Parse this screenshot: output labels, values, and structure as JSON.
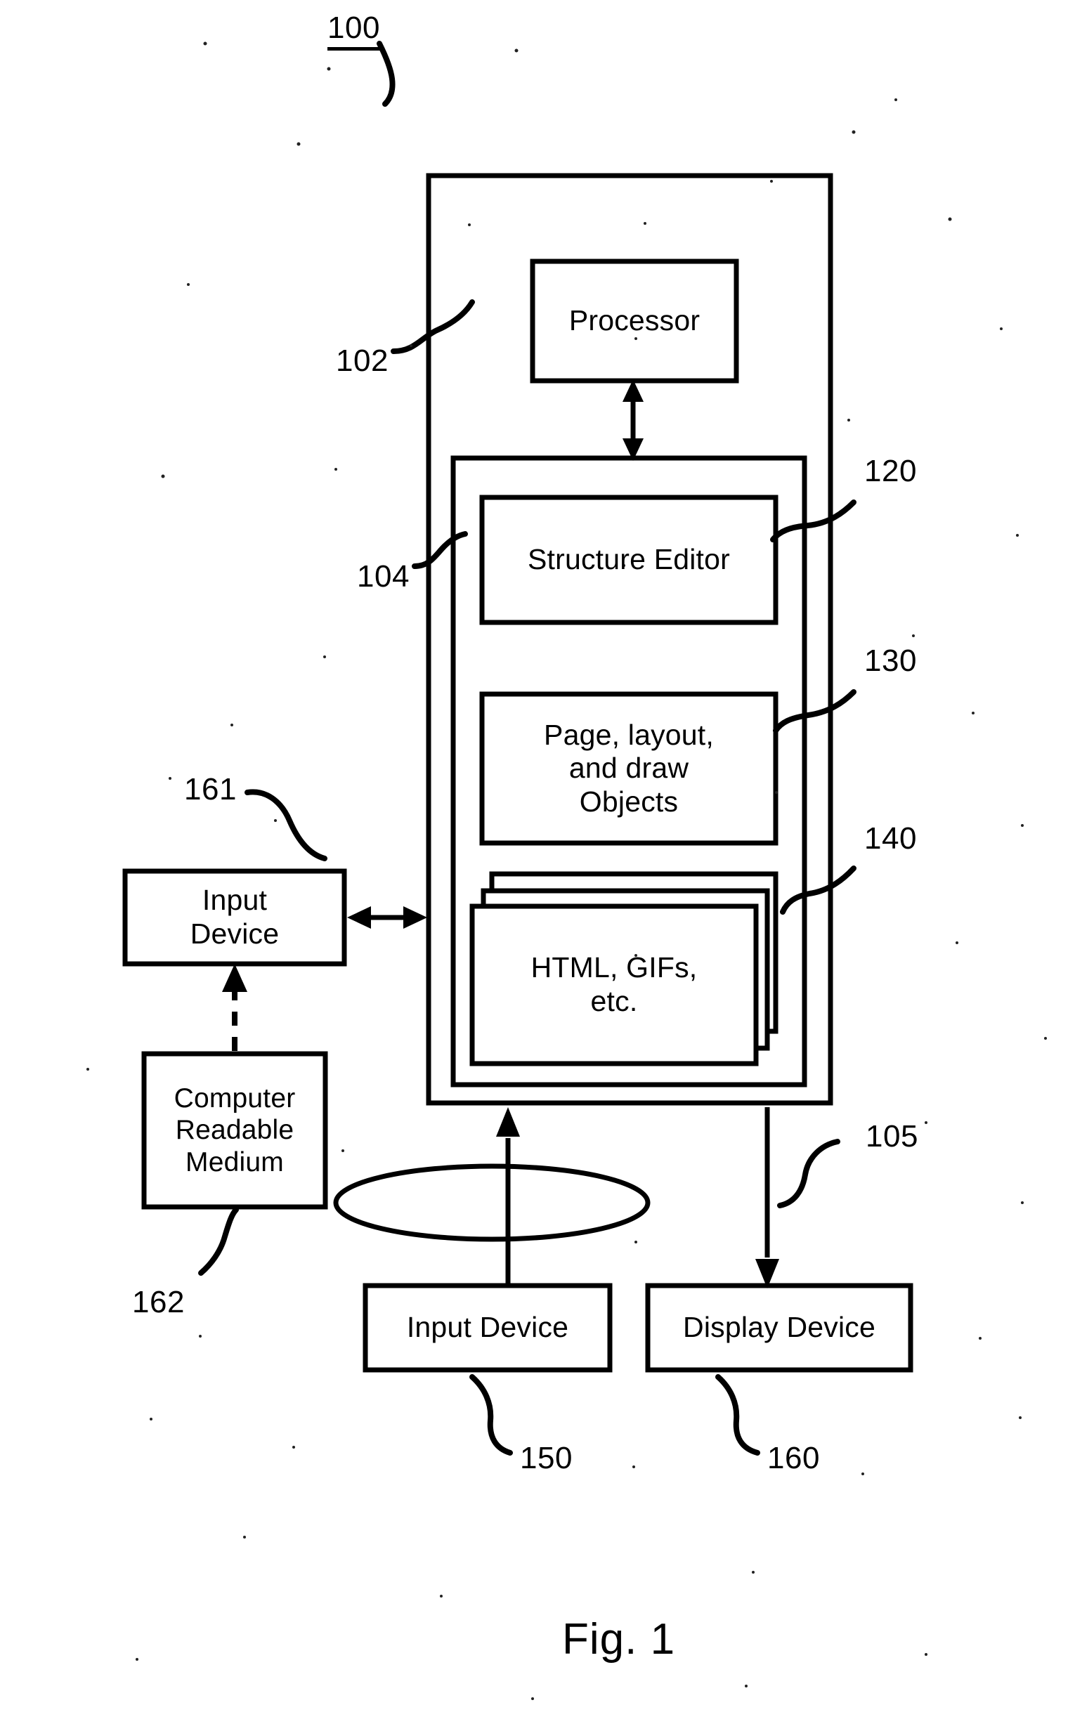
{
  "figure": {
    "number_label": "100",
    "caption": "Fig. 1"
  },
  "reference_numerals": {
    "system": "100",
    "computer_outer": "102",
    "memory_container": "104",
    "bus": "105",
    "structure_editor": "120",
    "page_layout_objects": "130",
    "content_files": "140",
    "input_device_bottom": "150",
    "display_device": "160",
    "input_device_left": "161",
    "computer_readable_medium": "162"
  },
  "blocks": {
    "processor": {
      "label": "Processor",
      "lines": [
        "Processor"
      ]
    },
    "structure_editor": {
      "label": "Structure Editor",
      "lines": [
        "Structure Editor"
      ]
    },
    "page_layout_objects": {
      "label": "Page, layout, and draw Objects",
      "lines": [
        "Page, layout,",
        "and draw",
        "Objects"
      ]
    },
    "content_files": {
      "label": "HTML, GIFs, etc.",
      "lines": [
        "HTML, GIFs,",
        "etc."
      ]
    },
    "input_device_left": {
      "label": "Input Device",
      "lines": [
        "Input",
        "Device"
      ]
    },
    "computer_readable_medium": {
      "label": "Computer Readable Medium",
      "lines": [
        "Computer",
        "Readable",
        "Medium"
      ]
    },
    "input_device_bottom": {
      "label": "Input Device",
      "lines": [
        "Input Device"
      ]
    },
    "display_device": {
      "label": "Display Device",
      "lines": [
        "Display Device"
      ]
    }
  },
  "colors": {
    "ink": "#000000",
    "paper": "#ffffff"
  },
  "connectors": [
    {
      "name": "processor-to-memory",
      "style": "double-arrow",
      "orientation": "vertical"
    },
    {
      "name": "input-device-left-to-computer",
      "style": "double-arrow",
      "orientation": "horizontal"
    },
    {
      "name": "medium-to-input-device-left",
      "style": "dashed-arrow-up",
      "orientation": "vertical"
    },
    {
      "name": "input-device-bottom-to-computer",
      "style": "arrow-up",
      "orientation": "vertical"
    },
    {
      "name": "computer-to-display-device",
      "style": "arrow-down",
      "orientation": "vertical"
    }
  ]
}
